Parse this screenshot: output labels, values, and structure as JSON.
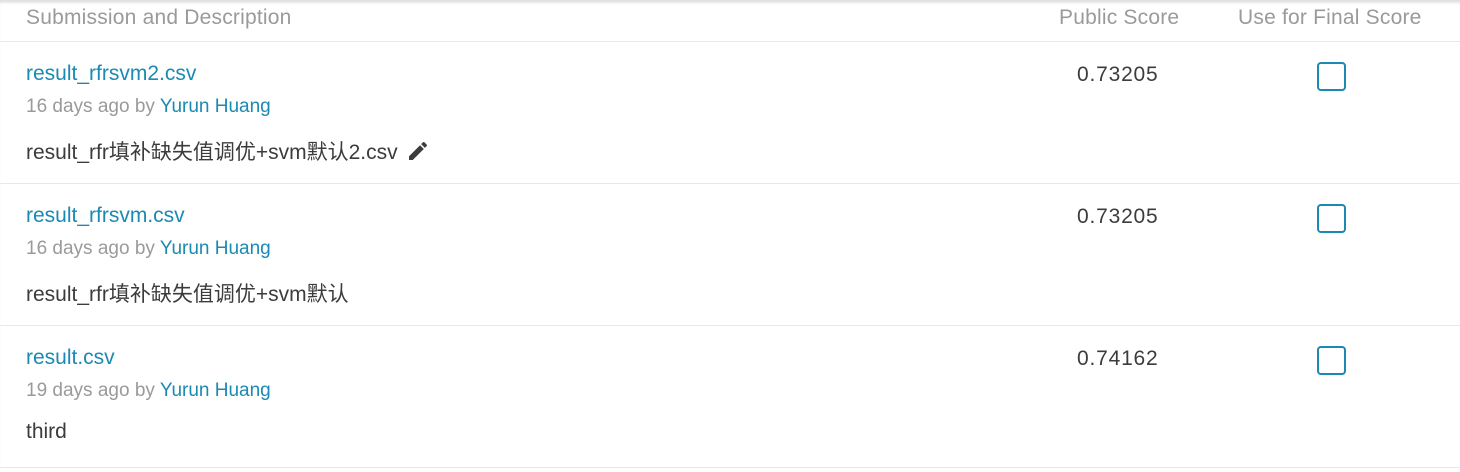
{
  "header": {
    "submission_label": "Submission and Description",
    "public_score_label": "Public Score",
    "final_score_label": "Use for Final Score"
  },
  "submissions": [
    {
      "filename": "result_rfrsvm2.csv",
      "age": "16 days ago",
      "by": "by",
      "user": "Yurun Huang",
      "description": "result_rfr填补缺失值调优+svm默认2.csv",
      "public_score": "0.73205",
      "use_for_final": false,
      "editable_icon": "pencil-icon"
    },
    {
      "filename": "result_rfrsvm.csv",
      "age": "16 days ago",
      "by": "by",
      "user": "Yurun Huang",
      "description": "result_rfr填补缺失值调优+svm默认",
      "public_score": "0.73205",
      "use_for_final": false
    },
    {
      "filename": "result.csv",
      "age": "19 days ago",
      "by": "by",
      "user": "Yurun Huang",
      "description": "third",
      "public_score": "0.74162",
      "use_for_final": false
    }
  ],
  "colors": {
    "link": "#1a8ab3",
    "muted": "#9a9a9a",
    "text": "#3c3c3c",
    "divider": "#e8e8e8"
  }
}
